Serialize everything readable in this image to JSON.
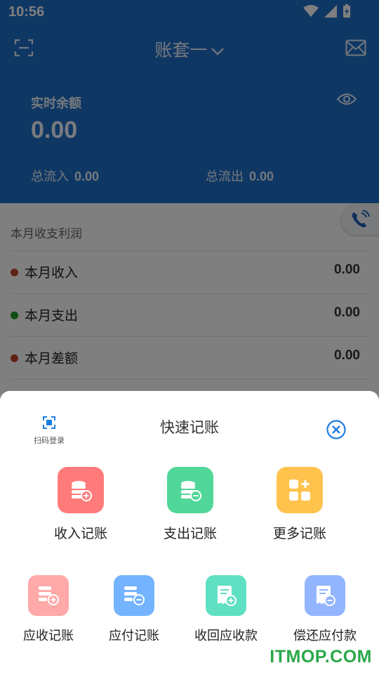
{
  "status_bar": {
    "time": "10:56"
  },
  "nav": {
    "ledger_title": "账套一"
  },
  "summary": {
    "balance_label": "实时余额",
    "balance_value": "0.00",
    "total_in_label": "总流入",
    "total_in_value": "0.00",
    "total_out_label": "总流出",
    "total_out_value": "0.00"
  },
  "month": {
    "section_title": "本月收支利润",
    "rows": [
      {
        "label": "本月收入",
        "value": "0.00",
        "dot_color": "#c0452a"
      },
      {
        "label": "本月支出",
        "value": "0.00",
        "dot_color": "#1a9a2a"
      },
      {
        "label": "本月差额",
        "value": "0.00",
        "dot_color": "#c0452a"
      }
    ]
  },
  "sheet": {
    "scan_login_label": "扫码登录",
    "title": "快速记账",
    "primary_actions": [
      {
        "label": "收入记账",
        "icon": "coin-plus-icon",
        "color": "#ff7b7b"
      },
      {
        "label": "支出记账",
        "icon": "coin-minus-icon",
        "color": "#52d79a"
      },
      {
        "label": "更多记账",
        "icon": "grid-plus-icon",
        "color": "#ffc34d"
      }
    ],
    "secondary_actions": [
      {
        "label": "应收记账",
        "icon": "receivable-icon",
        "color": "#ffa9a9"
      },
      {
        "label": "应付记账",
        "icon": "payable-icon",
        "color": "#73b3ff"
      },
      {
        "label": "收回应收款",
        "icon": "collect-receivable-icon",
        "color": "#5fe0c2"
      },
      {
        "label": "偿还应付款",
        "icon": "repay-payable-icon",
        "color": "#93b4ff"
      }
    ]
  },
  "watermark": "ITMOP.COM",
  "colors": {
    "header_blue": "#1f6ec6",
    "accent_blue": "#1f7ce0"
  }
}
